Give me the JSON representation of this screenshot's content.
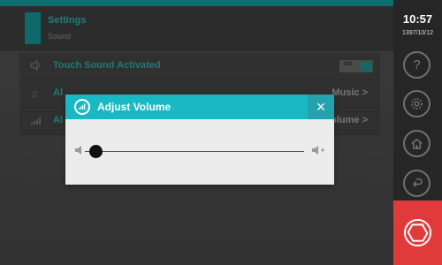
{
  "header": {
    "title": "Settings",
    "subtitle": "Sound"
  },
  "settings": {
    "touch_sound": {
      "label": "Touch Sound Activated",
      "toggle_text": "ON"
    },
    "alarm_sound": {
      "label": "Al",
      "value": "Music >"
    },
    "alarm_volume": {
      "label": "Al",
      "value": "olume >"
    }
  },
  "status": {
    "time": "10:57",
    "date": "1397/10/12"
  },
  "sidebar": {
    "icons": [
      "help-icon",
      "settings-icon",
      "home-icon",
      "back-icon",
      "stop-icon"
    ]
  },
  "dialog": {
    "title": "Adjust Volume",
    "close_glyph": "×",
    "volume_level": 0.02
  },
  "colors": {
    "accent": "#18b9c4",
    "stop": "#e13a3a",
    "dim_teal": "#1d7a7a"
  }
}
